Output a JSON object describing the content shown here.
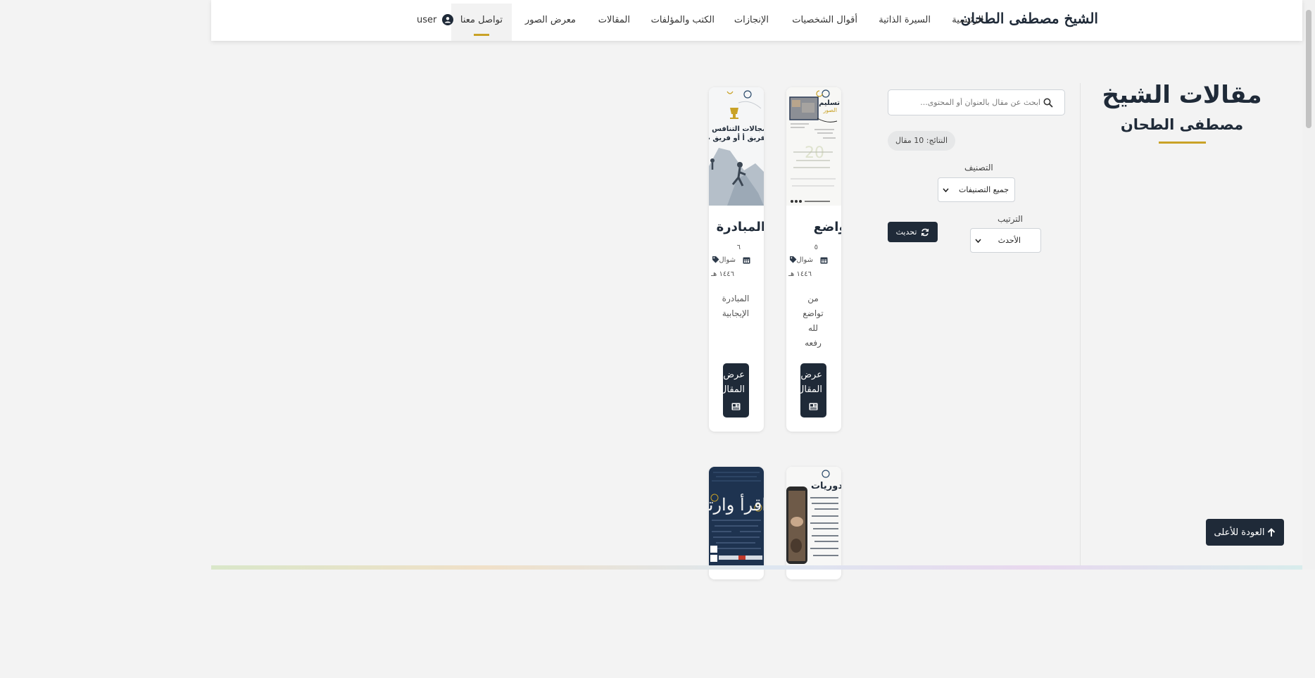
{
  "navbar": {
    "brand": "الشيخ مصطفى الطحان",
    "links": [
      "الرئيسية",
      "السيرة الذاتية",
      "أقوال الشخصيات",
      "الإنجازات",
      "الكتب والمؤلفات",
      "المقالات",
      "معرض الصور",
      "تواصل معنا"
    ],
    "active_link": "تواصل معنا",
    "user_label": "user"
  },
  "page": {
    "title": "مقالات الشيخ",
    "subtitle": "مصطفى الطحان",
    "accent_color": "#c9a227",
    "primary_color": "#1f2a38"
  },
  "filters": {
    "search_placeholder": "ابحث عن مقال بالعنوان أو المحتوى...",
    "results": "النتائج: 10 مقال",
    "category_label": "التصنيف",
    "category_value": "جميع التصنيفات",
    "sort_label": "الترتيب",
    "sort_value": "الأحدث",
    "refresh_label": "تحديث"
  },
  "articles": [
    {
      "title": "التواضع",
      "day": "٥",
      "month": "شوال",
      "year": "١٤٤٦ هـ",
      "excerpt_lines": [
        "من",
        "تواضع",
        "لله",
        "رفعه"
      ],
      "button_label": "عرض المقال",
      "image": {
        "headline": "تسليم",
        "subhead": "الصور"
      }
    },
    {
      "title": "المبادرة",
      "day": "٦",
      "month": "شوال",
      "year": "١٤٤٦ هـ",
      "excerpt_lines": [
        "المبادرة",
        "الإيجابية"
      ],
      "button_label": "عرض المقال",
      "image": {
        "headline": "مجالات التنافس بين",
        "subhead": "فريق أ أو فريق ب"
      }
    },
    {
      "title": "",
      "image": {
        "headline": "دوريات"
      }
    },
    {
      "title": "",
      "image": {
        "headline": "اقرأ وارتق"
      }
    }
  ],
  "back_to_top": "العودة للأعلى"
}
